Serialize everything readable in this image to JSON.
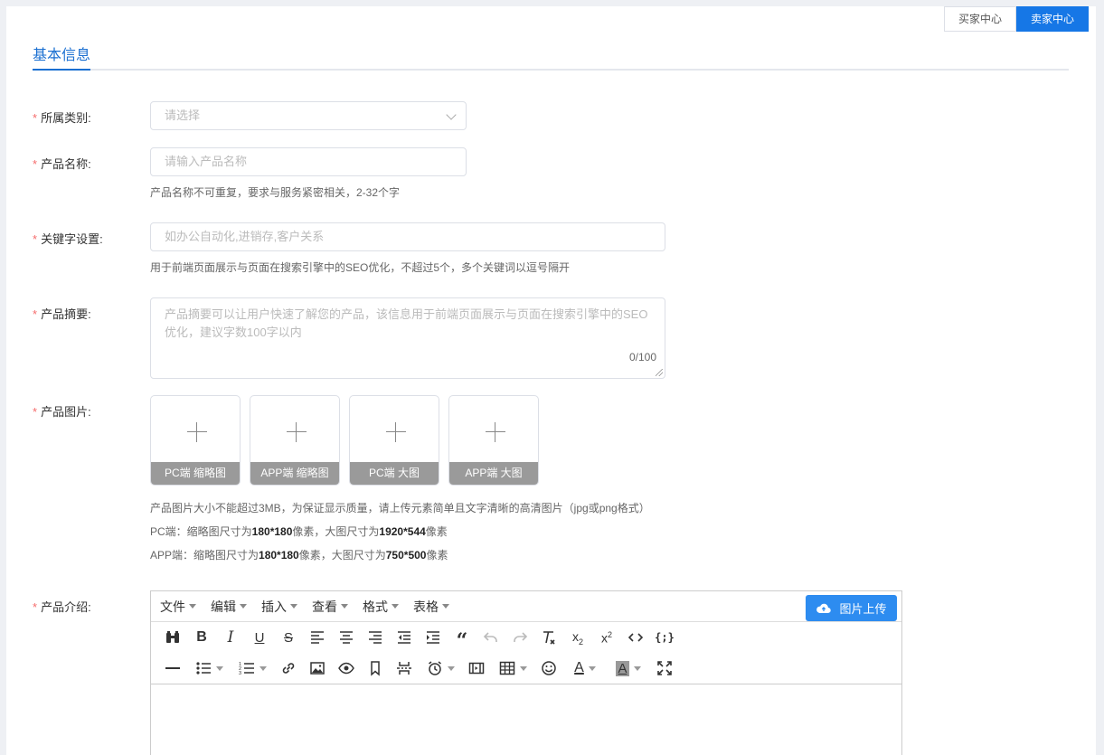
{
  "header": {
    "buyer_center": "买家中心",
    "seller_center": "卖家中心"
  },
  "tab": {
    "label": "基本信息"
  },
  "form": {
    "category": {
      "label": "所属类别:",
      "placeholder": "请选择"
    },
    "name": {
      "label": "产品名称:",
      "placeholder": "请输入产品名称",
      "hint": "产品名称不可重复，要求与服务紧密相关，2-32个字"
    },
    "keywords": {
      "label": "关键字设置:",
      "placeholder": "如办公自动化,进销存,客户关系",
      "hint": "用于前端页面展示与页面在搜索引擎中的SEO优化，不超过5个，多个关键词以逗号隔开"
    },
    "summary": {
      "label": "产品摘要:",
      "placeholder": "产品摘要可以让用户快速了解您的产品，该信息用于前端页面展示与页面在搜索引擎中的SEO优化，建议字数100字以内",
      "count": "0/100"
    },
    "images": {
      "label": "产品图片:",
      "slots": [
        "PC端 缩略图",
        "APP端 缩略图",
        "PC端 大图",
        "APP端 大图"
      ],
      "hint1": "产品图片大小不能超过3MB，为保证显示质量，请上传元素简单且文字清晰的高清图片（jpg或png格式）",
      "hint2_pre": "PC端：缩略图尺寸为",
      "hint2_a": "180*180",
      "hint2_mid": "像素，大图尺寸为",
      "hint2_b": "1920*544",
      "hint2_post": "像素",
      "hint3_pre": "APP端：缩略图尺寸为",
      "hint3_a": "180*180",
      "hint3_mid": "像素，大图尺寸为",
      "hint3_b": "750*500",
      "hint3_post": "像素"
    },
    "intro": {
      "label": "产品介绍:"
    }
  },
  "editor": {
    "menus": [
      "文件",
      "编辑",
      "插入",
      "查看",
      "格式",
      "表格"
    ],
    "upload_label": "图片上传",
    "toolbar_row1": [
      "find-icon",
      "bold-icon",
      "italic-icon",
      "underline-icon",
      "strikethrough-icon",
      "align-left-icon",
      "align-center-icon",
      "align-right-icon",
      "outdent-icon",
      "indent-icon",
      "blockquote-icon",
      "undo-icon",
      "redo-icon",
      "clear-format-icon",
      "subscript-icon",
      "superscript-icon",
      "code-icon",
      "code-sample-icon"
    ],
    "toolbar_row2": [
      "horizontal-rule-icon",
      "bullet-list-icon",
      "numbered-list-icon",
      "link-icon",
      "image-icon",
      "preview-icon",
      "bookmark-icon",
      "page-break-icon",
      "datetime-icon",
      "media-icon",
      "table-icon",
      "emoticon-icon",
      "text-color-icon",
      "background-color-icon",
      "fullscreen-icon"
    ]
  },
  "colors": {
    "primary": "#1677e6",
    "required": "#f56c6c",
    "upload_caption_bg": "#9a9a9a"
  }
}
